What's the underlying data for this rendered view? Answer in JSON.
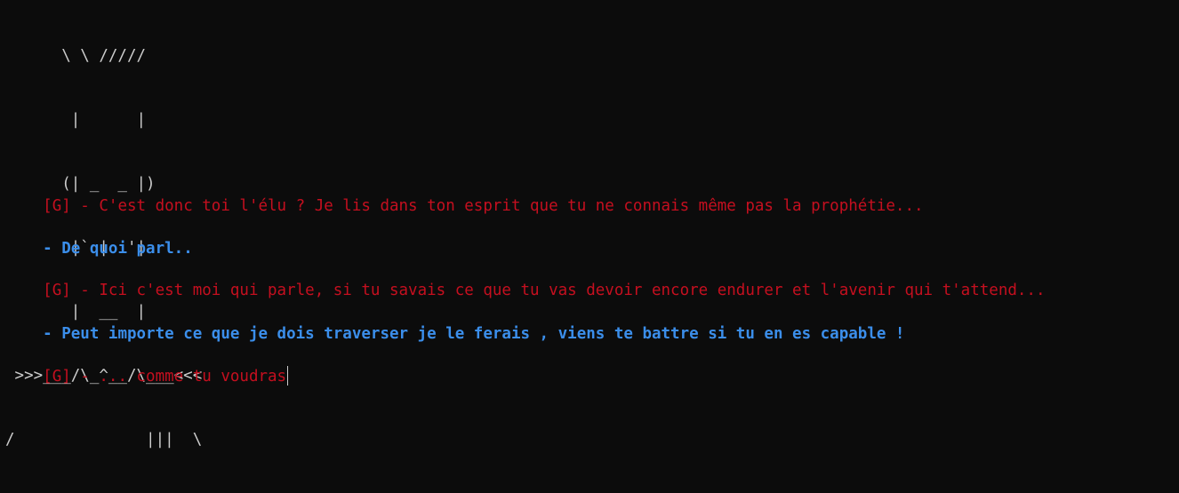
{
  "ascii_art": [
    "      \\ \\ /////",
    "       |      |",
    "      (| _  _ |)",
    "       |` |  '|",
    "       |  __  |",
    " >>>___/\\_^__/\\___<<<",
    "/              |||  \\"
  ],
  "dialogue": [
    {
      "speaker": "G",
      "text": "[G] - C'est donc toi l'élu ? Je lis dans ton esprit que tu ne connais même pas la prophétie..."
    },
    {
      "speaker": "hero",
      "text": "- De quoi parl.."
    },
    {
      "speaker": "G",
      "text": "[G] - Ici c'est moi qui parle, si tu savais ce que tu vas devoir encore endurer et l'avenir qui t'attend..."
    },
    {
      "speaker": "hero",
      "text": "- Peut importe ce que je dois traverser je le ferais , viens te battre si tu en es capable !"
    },
    {
      "speaker": "G",
      "text": "[G] - ... comme tu voudras"
    }
  ],
  "colors": {
    "background": "#0c0c0c",
    "ascii": "#cccccc",
    "speaker_g": "#c50f1f",
    "speaker_hero": "#3b8eea"
  }
}
